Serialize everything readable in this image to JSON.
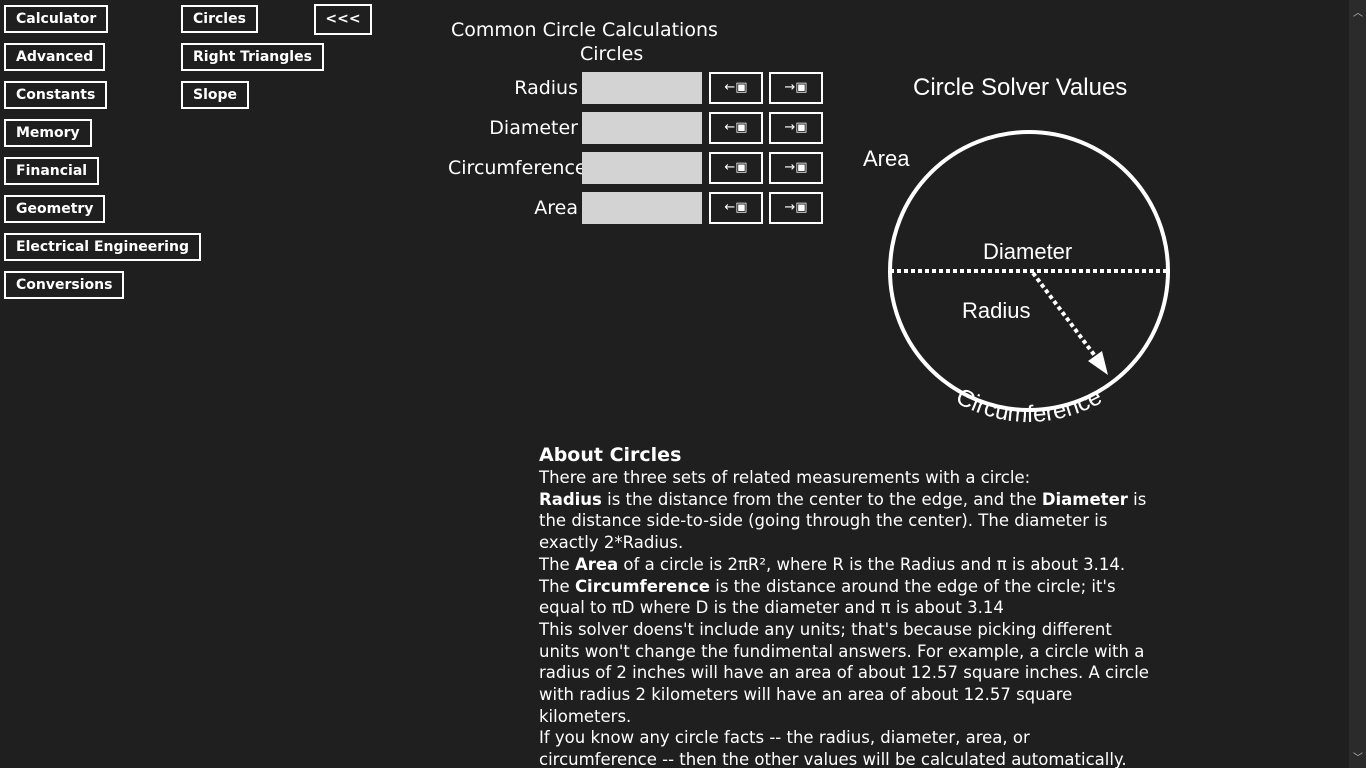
{
  "nav": {
    "col1": [
      "Calculator",
      "Advanced",
      "Constants",
      "Memory",
      "Financial",
      "Geometry",
      "Electrical Engineering",
      "Conversions"
    ],
    "col2": [
      "Circles",
      "Right Triangles",
      "Slope"
    ],
    "back_label": "<<<"
  },
  "solver": {
    "title": "Common Circle Calculations",
    "subtitle": "Circles",
    "fields": [
      {
        "label": "Radius",
        "value": ""
      },
      {
        "label": "Diameter",
        "value": ""
      },
      {
        "label": "Circumference",
        "value": ""
      },
      {
        "label": "Area",
        "value": ""
      }
    ],
    "load_button_label": "←▣",
    "store_button_label": "→▣"
  },
  "diagram": {
    "title": "Circle Solver Values",
    "area_label": "Area",
    "diameter_label": "Diameter",
    "radius_label": "Radius",
    "circumference_label": "Circumference"
  },
  "about": {
    "heading": "About Circles",
    "intro": "There are three sets of related measurements with a circle:",
    "p1_b1": "Radius",
    "p1_t1": " is the distance from the center to the edge, and the ",
    "p1_b2": "Diameter",
    "p1_t2": " is the distance side-to-side (going through the center). The diameter is exactly 2*Radius.",
    "p2_t1": "The ",
    "p2_b1": "Area",
    "p2_t2": " of a circle is 2πR², where R is the Radius and π is about 3.14.",
    "p3_t1": "The ",
    "p3_b1": "Circumference",
    "p3_t2": " is the distance around the edge of the circle; it's equal to πD where D is the diameter and π is about 3.14",
    "p4": "This solver doens't include any units; that's because picking different units won't change the fundimental answers. For example, a circle with a radius of 2 inches will have an area of about 12.57 square inches. A circle with radius 2 kilometers will have an area of about 12.57 square kilometers.",
    "p5": "If you know any circle facts -- the radius, diameter, area, or circumference -- then the other values will be calculated automatically."
  }
}
